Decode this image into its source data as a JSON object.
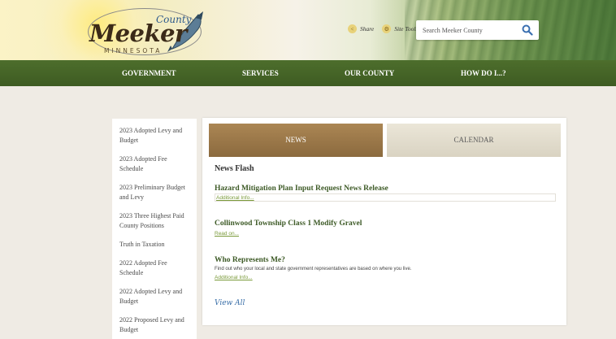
{
  "header": {
    "logo": {
      "county": "County",
      "name": "Meeker",
      "state": "MINNESOTA"
    },
    "share_label": "Share",
    "site_tools_label": "Site Tools",
    "search": {
      "placeholder": "Search Meeker County"
    }
  },
  "nav": {
    "items": [
      {
        "label": "GOVERNMENT"
      },
      {
        "label": "SERVICES"
      },
      {
        "label": "OUR COUNTY"
      },
      {
        "label": "HOW DO I...?"
      }
    ]
  },
  "sidebar": {
    "links": [
      {
        "label": "2023 Adopted Levy and Budget"
      },
      {
        "label": "2023 Adopted Fee Schedule"
      },
      {
        "label": "2023 Preliminary Budget and Levy"
      },
      {
        "label": "2023 Three Highest Paid County Positions"
      },
      {
        "label": "Truth in Taxation"
      },
      {
        "label": "2022 Adopted Fee Schedule"
      },
      {
        "label": "2022 Adopted Levy and Budget"
      },
      {
        "label": "2022 Proposed Levy and Budget"
      }
    ]
  },
  "main": {
    "tabs": {
      "news": "NEWS",
      "calendar": "CALENDAR"
    },
    "section_title": "News Flash",
    "items": [
      {
        "title": "Hazard Mitigation Plan Input Request News Release",
        "link": "Additional Info..."
      },
      {
        "title": "Collinwood Township Class 1 Modify Gravel",
        "link": "Read on..."
      },
      {
        "title": "Who Represents Me?",
        "description": "Find out who your local and state government representatives are based on where you live.",
        "link": "Additional Info..."
      }
    ],
    "view_all": "View All"
  },
  "colors": {
    "nav_green": "#4d6e2c",
    "news_tab_brown": "#9b7849",
    "headline_green": "#3d5a26",
    "link_green": "#7a9a3a",
    "view_all_blue": "#3a6fa8"
  },
  "icons": [
    "share-icon",
    "gear-icon",
    "search-icon",
    "fish-icon"
  ]
}
